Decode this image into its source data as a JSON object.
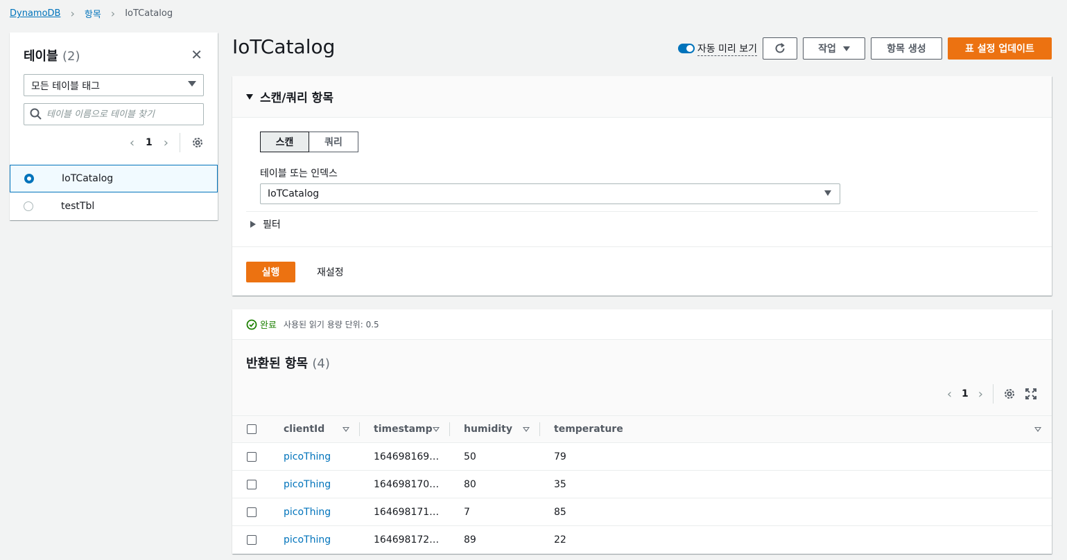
{
  "breadcrumb": {
    "root": "DynamoDB",
    "items": "항목",
    "current": "IoTCatalog"
  },
  "sidebar": {
    "title": "테이블",
    "count": "(2)",
    "tag_filter": "모든 테이블 태그",
    "search_placeholder": "테이블 이름으로 테이블 찾기",
    "page": "1",
    "tables": [
      {
        "name": "IoTCatalog",
        "selected": true
      },
      {
        "name": "testTbl",
        "selected": false
      }
    ]
  },
  "header": {
    "title": "IoTCatalog",
    "auto_preview_label": "자동 미리 보기",
    "actions_label": "작업",
    "create_item_label": "항목 생성",
    "update_settings_label": "표 설정 업데이트"
  },
  "scan_query": {
    "section_title": "스캔/쿼리 항목",
    "tab_scan": "스캔",
    "tab_query": "쿼리",
    "table_or_index_label": "테이블 또는 인덱스",
    "table_or_index_value": "IoTCatalog",
    "filter_label": "필터",
    "run_label": "실행",
    "reset_label": "재설정"
  },
  "results": {
    "status_done": "완료",
    "status_rcu": "사용된 읽기 용량 단위: 0.5",
    "title": "반환된 항목",
    "count": "(4)",
    "page": "1",
    "columns": [
      "clientId",
      "timestamp",
      "humidity",
      "temperature"
    ],
    "rows": [
      {
        "clientId": "picoThing",
        "timestamp": "164698169…",
        "humidity": "50",
        "temperature": "79"
      },
      {
        "clientId": "picoThing",
        "timestamp": "164698170…",
        "humidity": "80",
        "temperature": "35"
      },
      {
        "clientId": "picoThing",
        "timestamp": "164698171…",
        "humidity": "7",
        "temperature": "85"
      },
      {
        "clientId": "picoThing",
        "timestamp": "164698172…",
        "humidity": "89",
        "temperature": "22"
      }
    ]
  },
  "colors": {
    "accent": "#ec7211",
    "link": "#0073bb",
    "success": "#1d8102"
  }
}
